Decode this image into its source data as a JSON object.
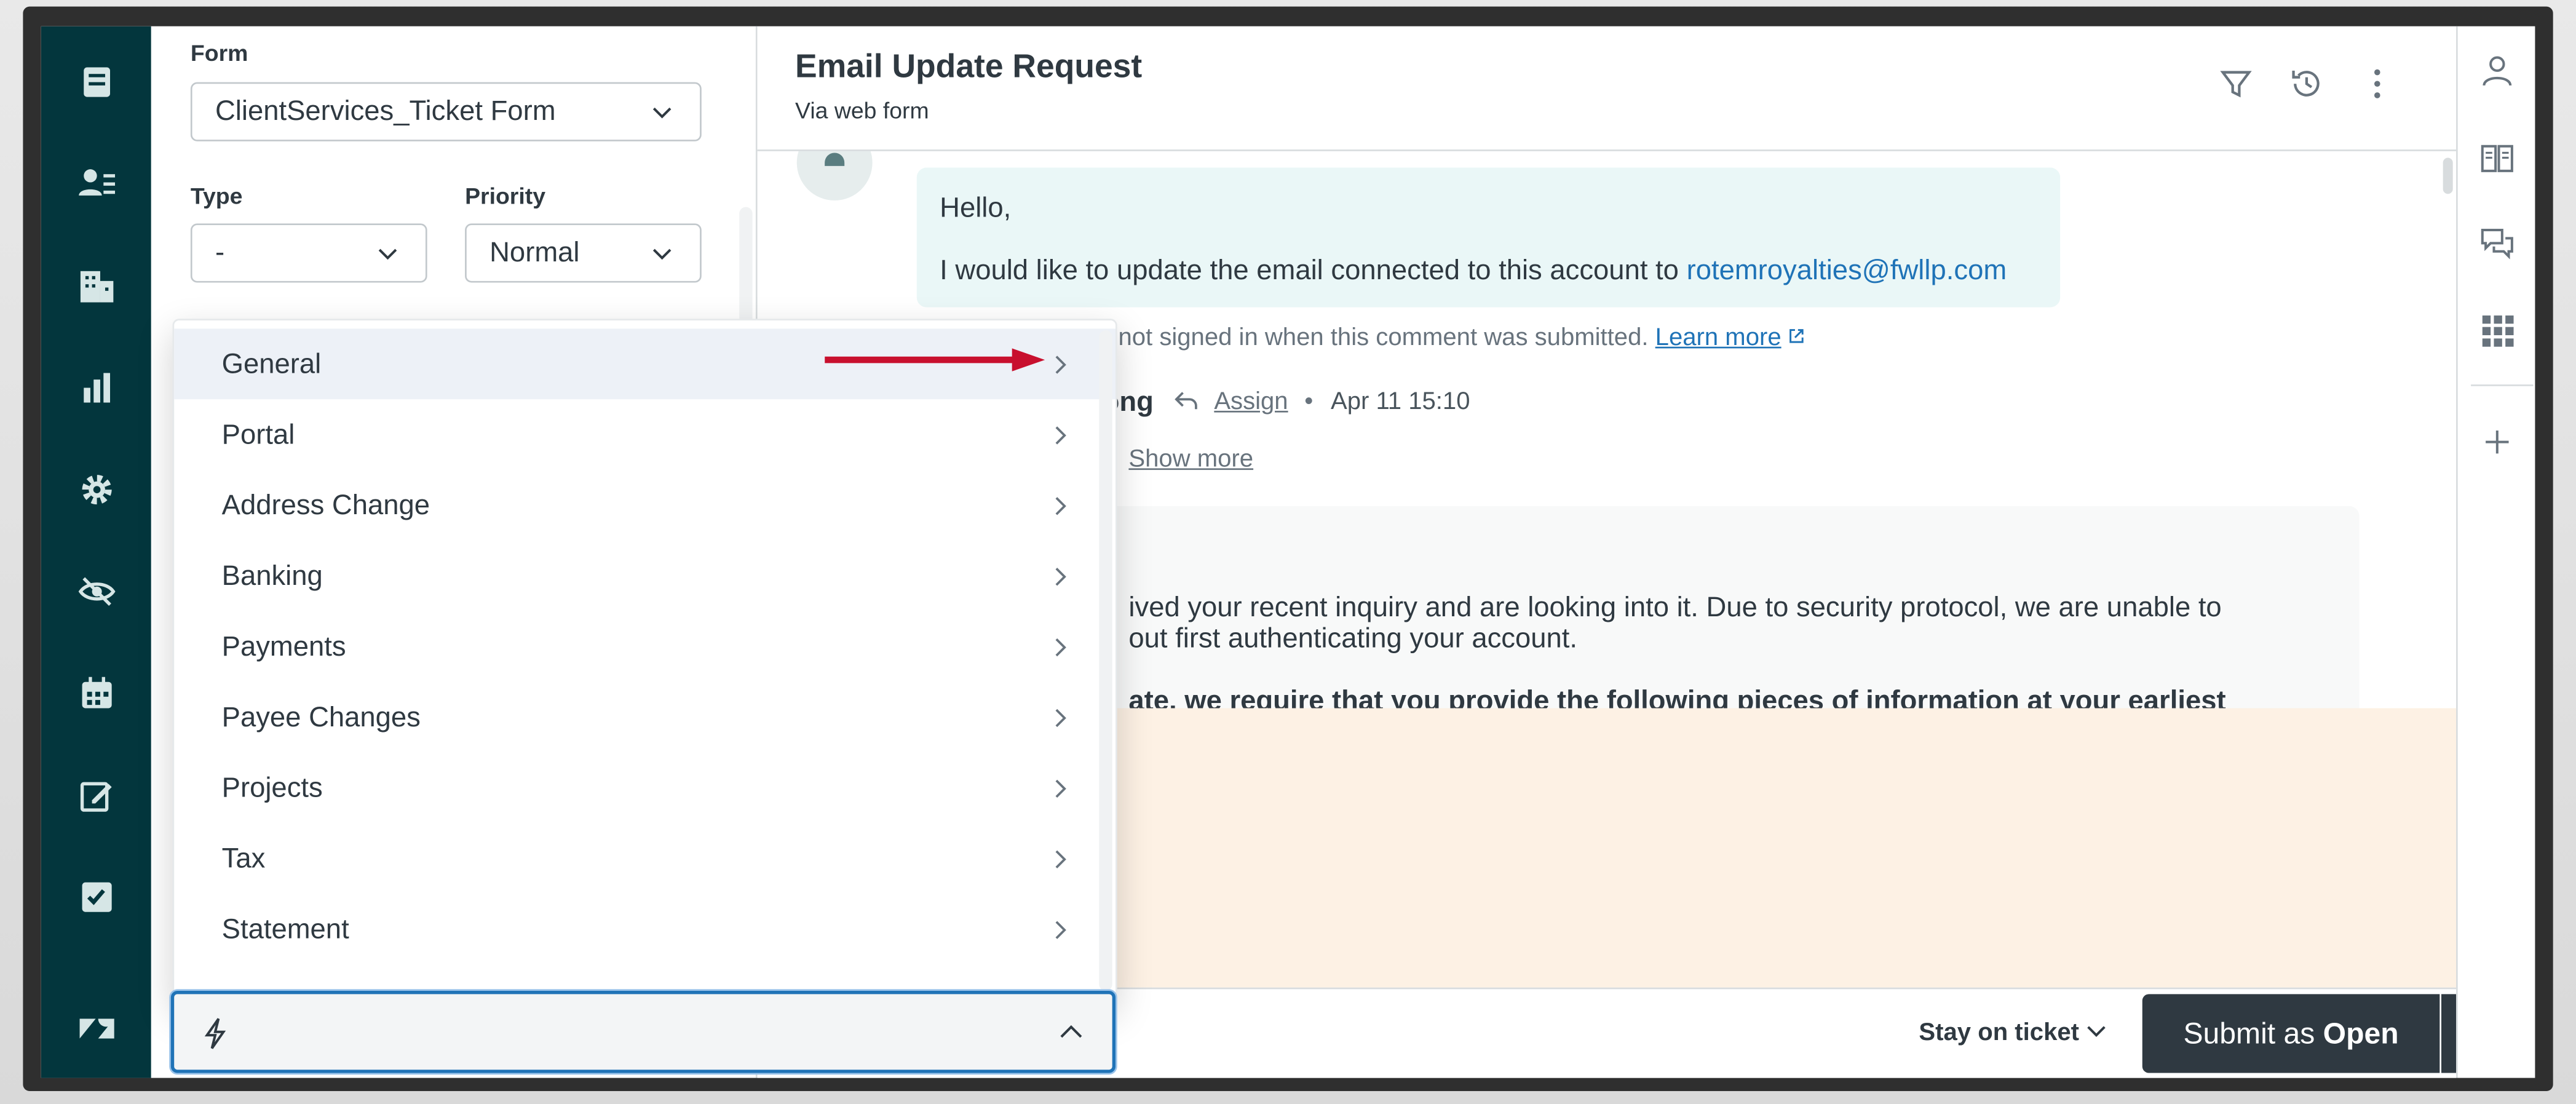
{
  "form": {
    "form_label": "Form",
    "form_value": "ClientServices_Ticket Form",
    "type_label": "Type",
    "type_value": "-",
    "priority_label": "Priority",
    "priority_value": "Normal"
  },
  "macro_menu": {
    "items": [
      {
        "label": "General"
      },
      {
        "label": "Portal"
      },
      {
        "label": "Address Change"
      },
      {
        "label": "Banking"
      },
      {
        "label": "Payments"
      },
      {
        "label": "Payee Changes"
      },
      {
        "label": "Projects"
      },
      {
        "label": "Tax"
      },
      {
        "label": "Statement"
      }
    ]
  },
  "ticket": {
    "title": "Email Update Request",
    "channel": "Via web form",
    "greeting": "Hello,",
    "message_prefix": "I would like to update the email connected to this account to ",
    "message_email": "rotemroyalties@fwllp.com",
    "signin_note": "s not signed in when this comment was submitted.",
    "learn_more": "Learn more",
    "agent_fragment": "ong",
    "assign": "Assign",
    "sep": "•",
    "timestamp": "Apr 11 15:10",
    "show_more": "Show more",
    "reply_line1": "ived your recent inquiry and are looking into it. Due to security protocol, we are unable to",
    "reply_line2": "out first authenticating your account.",
    "reply_line3": "ate, we require that you provide the following pieces of information at your earliest"
  },
  "footer": {
    "stay_label": "Stay on ticket",
    "submit_prefix": "Submit as ",
    "submit_status": "Open"
  },
  "colors": {
    "nav_bg": "#03363d",
    "accent": "#1f73b7",
    "annotation_arrow": "#c8102e",
    "submit_bg": "#2f3941",
    "compose_bg": "#fdf1e4"
  },
  "icons": {
    "nav": [
      "views-icon",
      "customers-icon",
      "organizations-icon",
      "reporting-icon",
      "admin-gear-icon",
      "hidden-eye-icon",
      "calendar-icon",
      "edit-icon",
      "checklist-icon",
      "zendesk-logo-icon"
    ],
    "header": [
      "filter-icon",
      "history-icon",
      "more-vertical-icon"
    ],
    "rail": [
      "user-icon",
      "knowledge-book-icon",
      "conversations-icon",
      "apps-grid-icon",
      "add-icon"
    ]
  }
}
